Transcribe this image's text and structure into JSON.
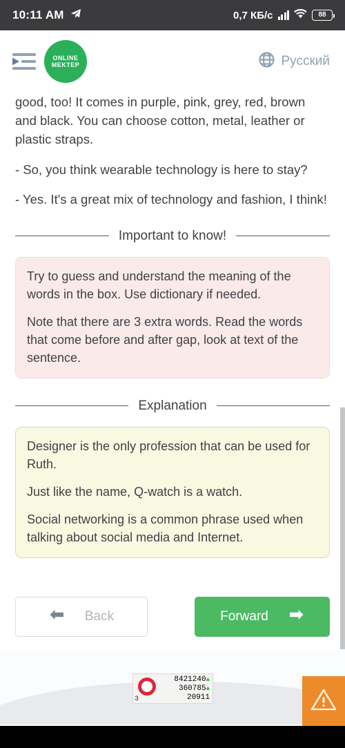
{
  "statusbar": {
    "time": "10:11 AM",
    "send_icon": "telegram-send-icon",
    "net_speed": "0,7 КБ/c",
    "signal_icon": "signal-bars-icon",
    "wifi_icon": "wifi-icon",
    "battery_level": "88"
  },
  "header": {
    "menu_icon": "indent-list-icon",
    "logo_line1": "ONLINE",
    "logo_line2": "MEKTEP",
    "logo_color": "#2bb05a",
    "globe_icon": "globe-icon",
    "language": "Русский"
  },
  "content": {
    "paragraphs": [
      "good, too! It comes in purple, pink, grey, red, brown and black. You can choose cotton, metal, leather or plastic straps.",
      "- So, you think wearable technology is here to stay?",
      "- Yes. It's a great mix of technology and fashion, I think!"
    ],
    "important": {
      "heading": "Important to know!",
      "bg_color": "#fbeaea",
      "paragraphs": [
        "Try to guess and understand the meaning of the words in the box. Use dictionary if needed.",
        "Note that there are 3 extra words. Read the words that come before and after gap, look at text of the sentence."
      ]
    },
    "explanation": {
      "heading": "Explanation",
      "bg_color": "#f9f8e1",
      "paragraphs": [
        "Designer is the only profession that can be used for Ruth.",
        "Just like the name, Q-watch is a watch.",
        "Social networking is a common phrase used when talking about social media and Internet."
      ]
    }
  },
  "buttons": {
    "back_label": "Back",
    "back_icon": "arrow-left-icon",
    "forward_label": "Forward",
    "forward_icon": "arrow-right-icon",
    "forward_color": "#4cb963"
  },
  "footer": {
    "counter": {
      "index": "3",
      "row1": "8421240",
      "row1_trend": "▲",
      "row2": "360785",
      "row2_trend": "▲",
      "row3": "20911"
    },
    "warning_icon": "warning-triangle-icon",
    "warning_color": "#ed8b2b"
  }
}
